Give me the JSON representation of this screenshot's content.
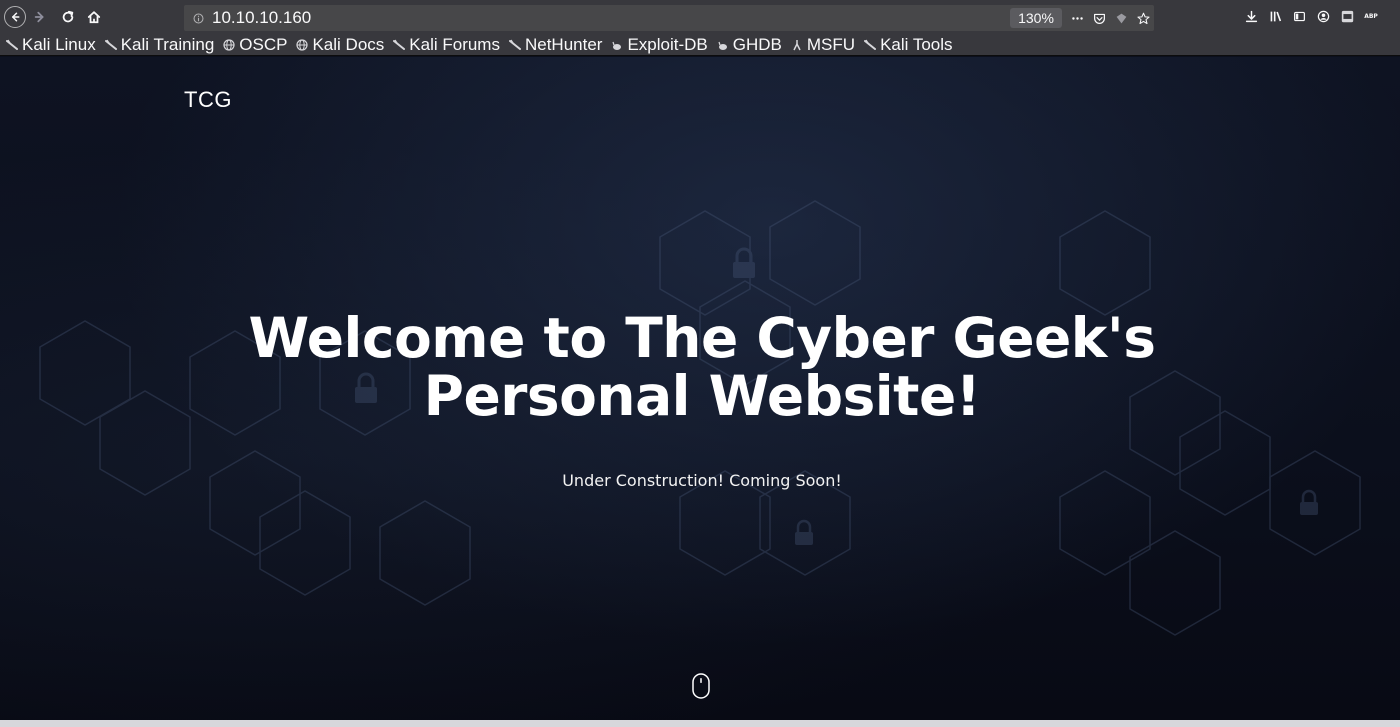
{
  "browser": {
    "url": "10.10.10.160",
    "zoom": "130%",
    "toolbar_extra_label": "ABP"
  },
  "bookmarks": [
    {
      "label": "Kali Linux",
      "icon": "kali-dragon-icon"
    },
    {
      "label": "Kali Training",
      "icon": "kali-dragon-icon"
    },
    {
      "label": "OSCP",
      "icon": "globe-icon"
    },
    {
      "label": "Kali Docs",
      "icon": "globe-icon"
    },
    {
      "label": "Kali Forums",
      "icon": "kali-dragon-icon"
    },
    {
      "label": "NetHunter",
      "icon": "kali-dragon-icon"
    },
    {
      "label": "Exploit-DB",
      "icon": "exploit-db-icon"
    },
    {
      "label": "GHDB",
      "icon": "exploit-db-icon"
    },
    {
      "label": "MSFU",
      "icon": "msfu-icon"
    },
    {
      "label": "Kali Tools",
      "icon": "kali-dragon-icon"
    }
  ],
  "site": {
    "brand": "TCG",
    "title_line1": "Welcome to The Cyber Geek's",
    "title_line2": "Personal Website!",
    "subtitle": "Under Construction! Coming Soon!"
  },
  "colors": {
    "toolbar_bg": "#38383d",
    "urlbar_bg": "#474749",
    "page_bg": "#0b0f1c",
    "text": "#ffffff"
  }
}
